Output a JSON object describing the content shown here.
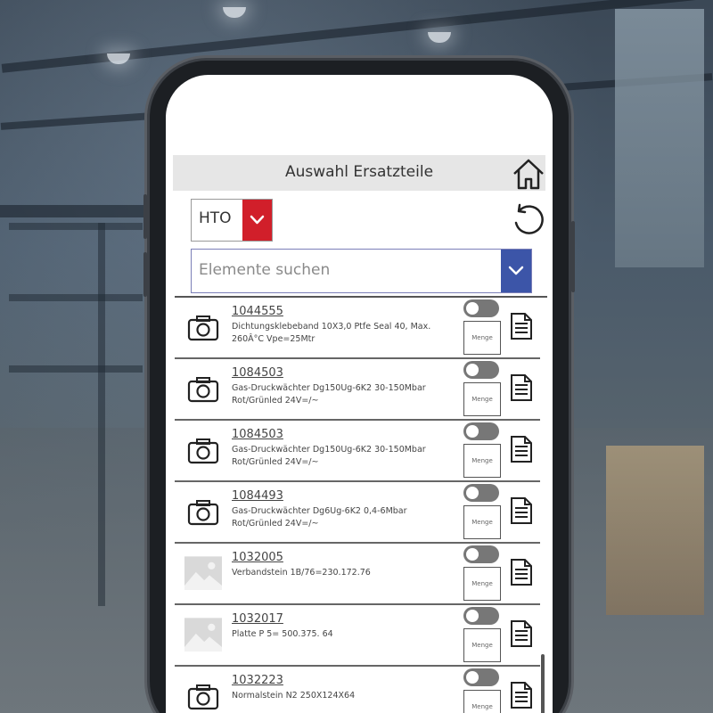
{
  "header": {
    "title": "Auswahl Ersatzteile"
  },
  "filter": {
    "selected": "HTO"
  },
  "search": {
    "placeholder": "Elemente suchen"
  },
  "items": [
    {
      "id": "1044555",
      "desc": "Dichtungsklebeband 10X3,0 Ptfe Seal 40, Max. 260Â°C Vpe=25Mtr",
      "image": "camera-icon",
      "qty_placeholder": "Menge"
    },
    {
      "id": "1084503",
      "desc": "Gas-Druckwächter Dg150Ug-6K2 30-150Mbar Rot/Grünled 24V=/~",
      "image": "camera-icon",
      "qty_placeholder": "Menge"
    },
    {
      "id": "1084503",
      "desc": "Gas-Druckwächter Dg150Ug-6K2 30-150Mbar Rot/Grünled 24V=/~",
      "image": "camera-icon",
      "qty_placeholder": "Menge"
    },
    {
      "id": "1084493",
      "desc": "Gas-Druckwächter Dg6Ug-6K2 0,4-6Mbar Rot/Grünled 24V=/~",
      "image": "camera-icon",
      "qty_placeholder": "Menge"
    },
    {
      "id": "1032005",
      "desc": "Verbandstein 1B/76=230.172.76",
      "image": "image-placeholder-icon",
      "qty_placeholder": "Menge"
    },
    {
      "id": "1032017",
      "desc": "Platte  P 5= 500.375. 64",
      "image": "image-placeholder-icon",
      "qty_placeholder": "Menge"
    },
    {
      "id": "1032223",
      "desc": "Normalstein N2 250X124X64",
      "image": "camera-icon",
      "qty_placeholder": "Menge"
    }
  ],
  "colors": {
    "accent_red": "#d11f2a",
    "accent_blue": "#3c55a8",
    "header_bg": "#e6e6e6"
  }
}
